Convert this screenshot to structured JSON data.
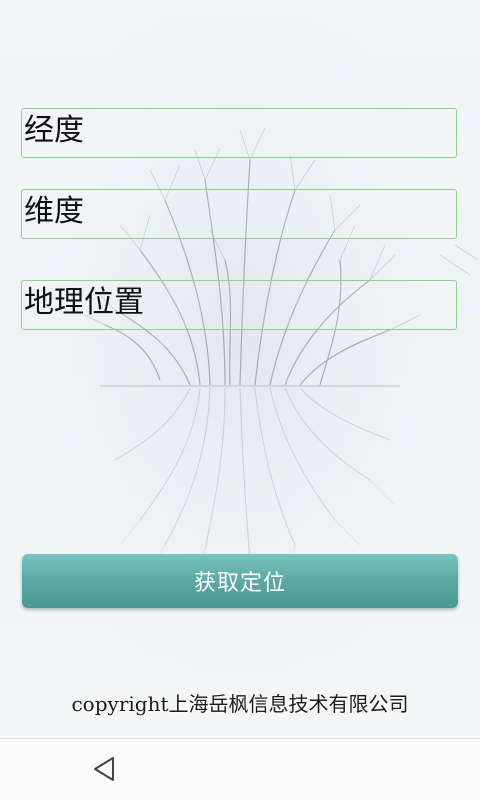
{
  "form": {
    "longitude_label": "经度",
    "latitude_label": "维度",
    "address_label": "地理位置"
  },
  "actions": {
    "locate_label": "获取定位"
  },
  "footer": {
    "copyright": "copyright上海岳枫信息技术有限公司"
  },
  "navigation": {
    "back_icon": "back-triangle-icon"
  },
  "colors": {
    "field_border": "#8fd08b",
    "button_top": "#79c6c0",
    "button_bottom": "#4a9892",
    "background": "#f1f4f7"
  }
}
